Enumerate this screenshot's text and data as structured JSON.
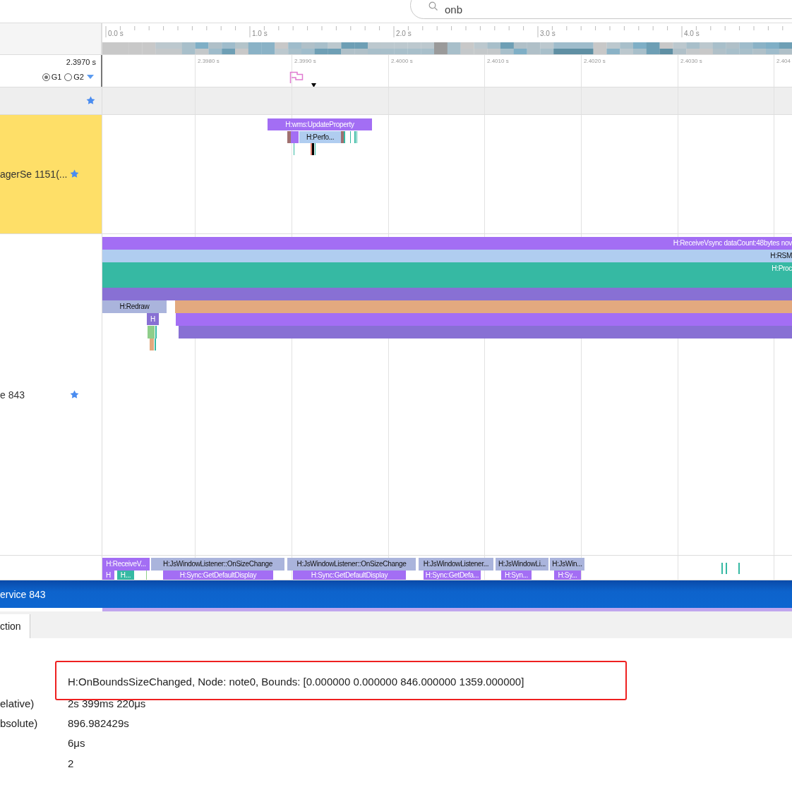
{
  "search": {
    "value": "onb"
  },
  "overview": {
    "ticks": [
      "0.0 s",
      "1.0 s",
      "2.0 s",
      "3.0 s",
      "4.0 s"
    ]
  },
  "timeline": {
    "start_label": "2.3970 s",
    "groups": [
      {
        "label": "G1",
        "selected": true
      },
      {
        "label": "G2",
        "selected": false
      }
    ],
    "ticks": [
      "2.3980 s",
      "2.3990 s",
      "2.4000 s",
      "2.4010 s",
      "2.4020 s",
      "2.4030 s",
      "2.404"
    ]
  },
  "tracks": [
    {
      "starred": true,
      "highlighted": false
    },
    {
      "name": "agerSe 1151(...",
      "starred": true,
      "highlighted": true,
      "slices": [
        {
          "label": "H:wms:UpdateProperty",
          "color": "#a36ef4"
        },
        {
          "color": "#a07070"
        },
        {
          "color": "#a36ef4"
        },
        {
          "label": "H:Perfo...",
          "color": "#b0cdf0"
        },
        {
          "color": "#a07070"
        },
        {
          "color": "#36b9a3"
        },
        {
          "color": "#36b9a3"
        },
        {
          "color": "#36b9a3"
        },
        {
          "color": "#36b9a3"
        },
        {
          "color": "#36b9a3"
        },
        {
          "color": "#e08070"
        },
        {
          "color": "#000000"
        },
        {
          "color": "#36b9a3"
        }
      ]
    },
    {
      "name": "e 843",
      "starred": true,
      "highlighted": false,
      "slices": [
        {
          "label": "H:ReceiveVsync dataCount:48bytes nov",
          "color": "#a36ef4"
        },
        {
          "label": "H:RSM",
          "color": "#b0cdf0"
        },
        {
          "label": "H:Proc",
          "color": "#36b9a3"
        },
        {
          "color": "#8870d4"
        },
        {
          "label": "H:Redraw",
          "color": "#aab4dc"
        },
        {
          "color": "#e3a97f"
        },
        {
          "label": "H",
          "color": "#8870d4"
        },
        {
          "color": "#a36ef4"
        },
        {
          "color": "#8870d4"
        },
        {
          "color": "#8fce8a"
        },
        {
          "color": "#36b9a3"
        },
        {
          "color": "#e3a97f"
        },
        {
          "color": "#36b9a3"
        }
      ]
    },
    {
      "starred": false,
      "highlighted": false,
      "slices": [
        {
          "label": "H:ReceiveV...",
          "color": "#a36ef4"
        },
        {
          "label": "H:JsWindowListener::OnSizeChange",
          "color": "#aab4dc"
        },
        {
          "label": "H:JsWindowListener::OnSizeChange",
          "color": "#aab4dc"
        },
        {
          "label": "H:JsWindowListener...",
          "color": "#aab4dc"
        },
        {
          "label": "H:JsWindowLi...",
          "color": "#aab4dc"
        },
        {
          "label": "H:JsWin...",
          "color": "#aab4dc"
        },
        {
          "label": "H",
          "color": "#a36ef4"
        },
        {
          "label": "H...",
          "color": "#36b9a3"
        },
        {
          "color": "#8fce8a"
        },
        {
          "label": "H:Sync:GetDefaultDisplay",
          "color": "#a36ef4"
        },
        {
          "label": "H:Sync:GetDefaultDisplay",
          "color": "#a36ef4"
        },
        {
          "label": "H:Sync:GetDefa...",
          "color": "#a36ef4"
        },
        {
          "label": "H:Syn...",
          "color": "#a36ef4"
        },
        {
          "label": "H:Sy...",
          "color": "#a36ef4"
        },
        {
          "color": "#36b9a3"
        },
        {
          "color": "#36b9a3"
        },
        {
          "color": "#36b9a3"
        }
      ]
    }
  ],
  "selected_thread": {
    "title": "ervice 843"
  },
  "tabs": [
    {
      "label": "ction",
      "selected": true
    }
  ],
  "details": {
    "highlighted_text": "H:OnBoundsSizeChanged, Node: note0, Bounds: [0.000000 0.000000 846.000000 1359.000000]",
    "rows": [
      {
        "label": "elative)",
        "value": "2s 399ms 220μs"
      },
      {
        "label": "bsolute)",
        "value": "896.982429s"
      },
      {
        "value": "6μs"
      },
      {
        "value": "2"
      }
    ]
  }
}
